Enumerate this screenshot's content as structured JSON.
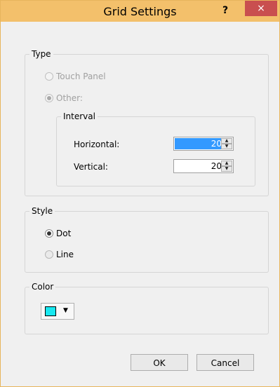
{
  "window": {
    "title": "Grid Settings",
    "help_label": "?",
    "close_label": "×",
    "titlebar_color": "#f3c06b",
    "close_color": "#c94f4f"
  },
  "type_group": {
    "legend": "Type",
    "touch_panel_label": "Touch Panel",
    "touch_panel_checked": false,
    "other_label": "Other:",
    "other_checked": true,
    "interval": {
      "legend": "Interval",
      "horizontal_label": "Horizontal:",
      "horizontal_value": "20",
      "vertical_label": "Vertical:",
      "vertical_value": "20"
    }
  },
  "style_group": {
    "legend": "Style",
    "dot_label": "Dot",
    "dot_checked": true,
    "line_label": "Line",
    "line_checked": false
  },
  "color_group": {
    "legend": "Color",
    "selected_color": "#18e8f0"
  },
  "buttons": {
    "ok_label": "OK",
    "cancel_label": "Cancel"
  }
}
